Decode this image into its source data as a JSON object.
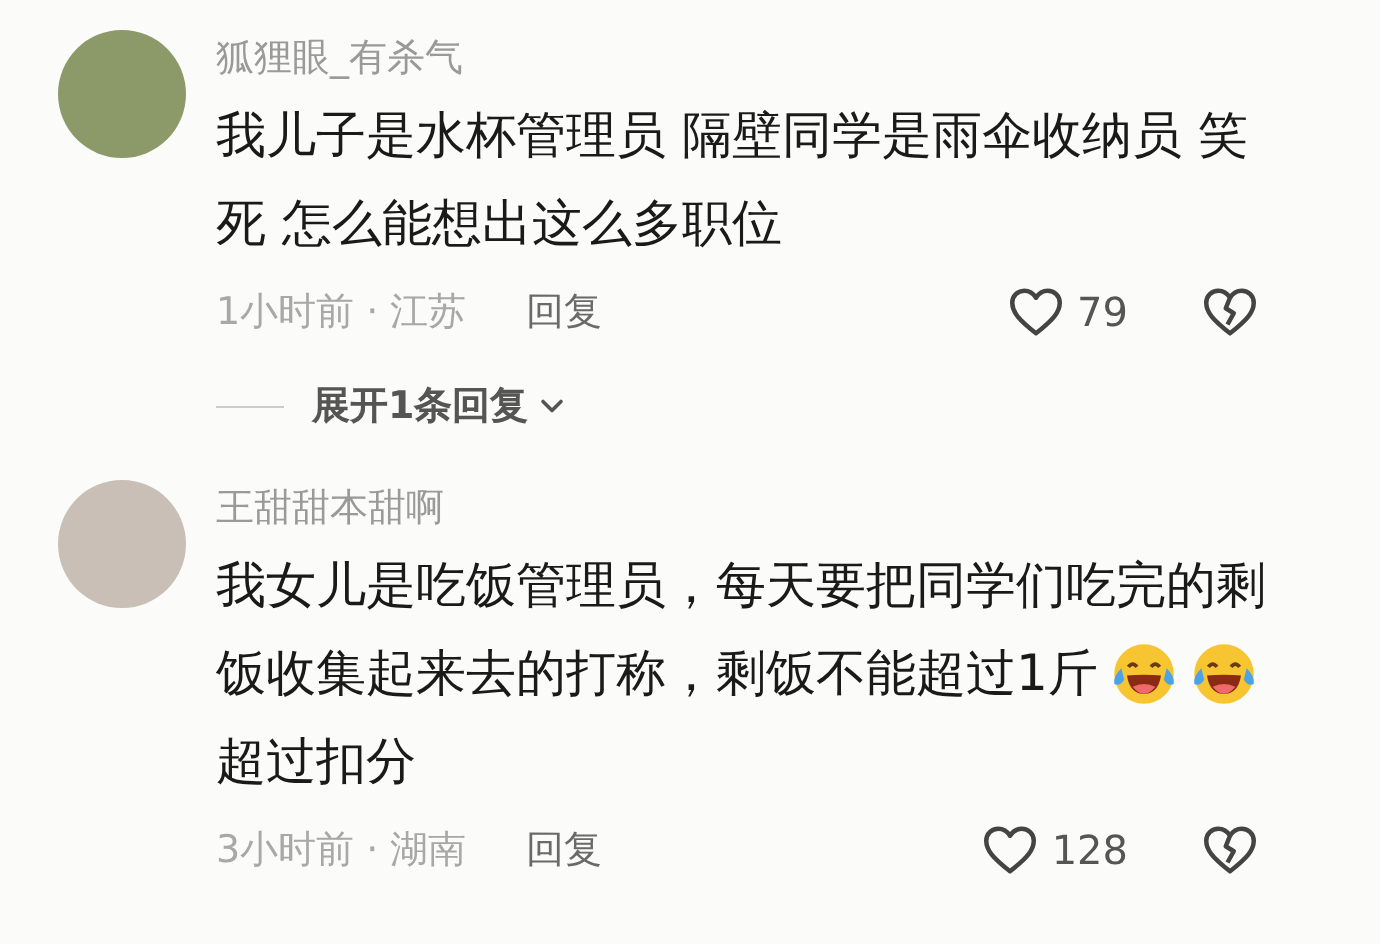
{
  "comments": [
    {
      "username": "狐狸眼_有杀气",
      "lines": [
        [
          {
            "kind": "text",
            "text": "我儿子是水杯管理员 隔壁同学是雨伞收纳员 笑"
          }
        ],
        [
          {
            "kind": "text",
            "text": "死 怎么能想出这么多职位"
          }
        ]
      ],
      "time_location": "1小时前 · 江苏",
      "reply_label": "回复",
      "likes": "79",
      "expand_replies": "展开1条回复"
    },
    {
      "username": "王甜甜本甜啊",
      "lines": [
        [
          {
            "kind": "text",
            "text": "我女儿是吃饭管理员，每天要把同学们吃完的剩"
          }
        ],
        [
          {
            "kind": "text",
            "text": "饭收集起来去的打称，剩饭不能超过1斤"
          },
          {
            "kind": "emoji"
          },
          {
            "kind": "emoji"
          }
        ],
        [
          {
            "kind": "text",
            "text": "超过扣分"
          }
        ]
      ],
      "time_location": "3小时前 · 湖南",
      "reply_label": "回复",
      "likes": "128"
    }
  ]
}
